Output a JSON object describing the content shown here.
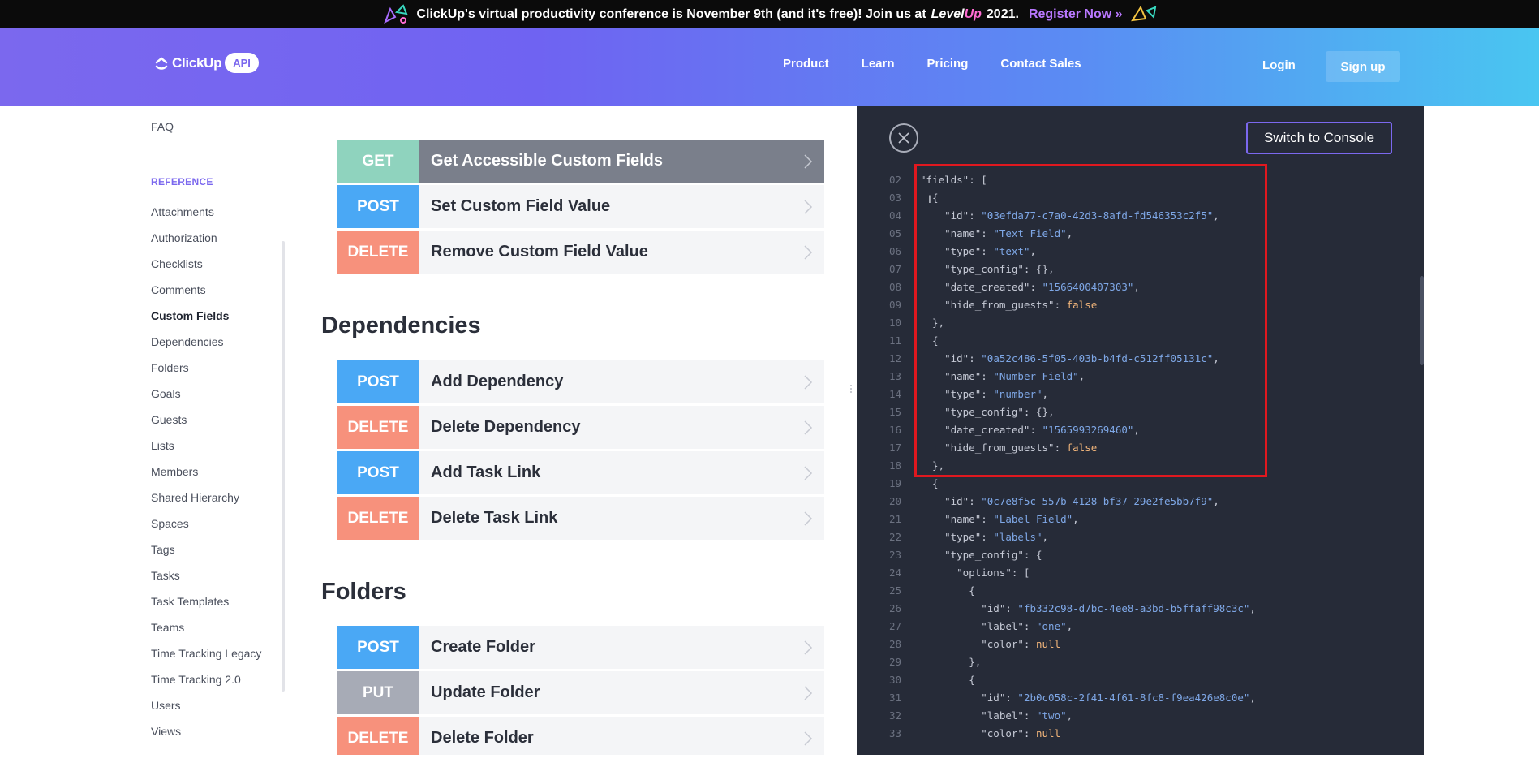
{
  "promo": {
    "text": "ClickUp's virtual productivity conference is November 9th (and it's free)! Join us at",
    "brand_level": "Level",
    "brand_up": "Up",
    "year": "2021.",
    "register": "Register Now »"
  },
  "header": {
    "brand": "ClickUp",
    "api_badge": "API",
    "nav": [
      "Product",
      "Learn",
      "Pricing",
      "Contact Sales"
    ],
    "login": "Login",
    "signup": "Sign up"
  },
  "sidebar": {
    "faq": "FAQ",
    "section": "REFERENCE",
    "items": [
      "Attachments",
      "Authorization",
      "Checklists",
      "Comments",
      "Custom Fields",
      "Dependencies",
      "Folders",
      "Goals",
      "Guests",
      "Lists",
      "Members",
      "Shared Hierarchy",
      "Spaces",
      "Tags",
      "Tasks",
      "Task Templates",
      "Teams",
      "Time Tracking Legacy",
      "Time Tracking 2.0",
      "Users",
      "Views"
    ],
    "active": "Custom Fields"
  },
  "main": {
    "custom_fields": [
      {
        "method": "GET",
        "title": "Get Accessible Custom Fields"
      },
      {
        "method": "POST",
        "title": "Set Custom Field Value"
      },
      {
        "method": "DELETE",
        "title": "Remove Custom Field Value"
      }
    ],
    "dependencies_heading": "Dependencies",
    "dependencies": [
      {
        "method": "POST",
        "title": "Add Dependency"
      },
      {
        "method": "DELETE",
        "title": "Delete Dependency"
      },
      {
        "method": "POST",
        "title": "Add Task Link"
      },
      {
        "method": "DELETE",
        "title": "Delete Task Link"
      }
    ],
    "folders_heading": "Folders",
    "folders": [
      {
        "method": "POST",
        "title": "Create Folder"
      },
      {
        "method": "PUT",
        "title": "Update Folder"
      },
      {
        "method": "DELETE",
        "title": "Delete Folder"
      }
    ]
  },
  "panel": {
    "switch_label": "Switch to Console",
    "code_lines": [
      {
        "n": "02",
        "t": "\"fields\": ["
      },
      {
        "n": "03",
        "t": "  {"
      },
      {
        "n": "04",
        "t": "    \"id\": \"03efda77-c7a0-42d3-8afd-fd546353c2f5\","
      },
      {
        "n": "05",
        "t": "    \"name\": \"Text Field\","
      },
      {
        "n": "06",
        "t": "    \"type\": \"text\","
      },
      {
        "n": "07",
        "t": "    \"type_config\": {},"
      },
      {
        "n": "08",
        "t": "    \"date_created\": \"1566400407303\","
      },
      {
        "n": "09",
        "t": "    \"hide_from_guests\": false"
      },
      {
        "n": "10",
        "t": "  },"
      },
      {
        "n": "11",
        "t": "  {"
      },
      {
        "n": "12",
        "t": "    \"id\": \"0a52c486-5f05-403b-b4fd-c512ff05131c\","
      },
      {
        "n": "13",
        "t": "    \"name\": \"Number Field\","
      },
      {
        "n": "14",
        "t": "    \"type\": \"number\","
      },
      {
        "n": "15",
        "t": "    \"type_config\": {},"
      },
      {
        "n": "16",
        "t": "    \"date_created\": \"1565993269460\","
      },
      {
        "n": "17",
        "t": "    \"hide_from_guests\": false"
      },
      {
        "n": "18",
        "t": "  },"
      },
      {
        "n": "19",
        "t": "  {"
      },
      {
        "n": "20",
        "t": "    \"id\": \"0c7e8f5c-557b-4128-bf37-29e2fe5bb7f9\","
      },
      {
        "n": "21",
        "t": "    \"name\": \"Label Field\","
      },
      {
        "n": "22",
        "t": "    \"type\": \"labels\","
      },
      {
        "n": "23",
        "t": "    \"type_config\": {"
      },
      {
        "n": "24",
        "t": "      \"options\": ["
      },
      {
        "n": "25",
        "t": "        {"
      },
      {
        "n": "26",
        "t": "          \"id\": \"fb332c98-d7bc-4ee8-a3bd-b5ffaff98c3c\","
      },
      {
        "n": "27",
        "t": "          \"label\": \"one\","
      },
      {
        "n": "28",
        "t": "          \"color\": null"
      },
      {
        "n": "29",
        "t": "        },"
      },
      {
        "n": "30",
        "t": "        {"
      },
      {
        "n": "31",
        "t": "          \"id\": \"2b0c058c-2f41-4f61-8fc8-f9ea426e8c0e\","
      },
      {
        "n": "32",
        "t": "          \"label\": \"two\","
      },
      {
        "n": "33",
        "t": "          \"color\": null"
      }
    ]
  },
  "colors": {
    "brand": "#7b68ee",
    "get": "#8fd3be",
    "post": "#4aa8f5",
    "delete": "#f7917c",
    "put": "#a7abb6",
    "panel_bg": "#262b38",
    "highlight": "#e0181f"
  }
}
